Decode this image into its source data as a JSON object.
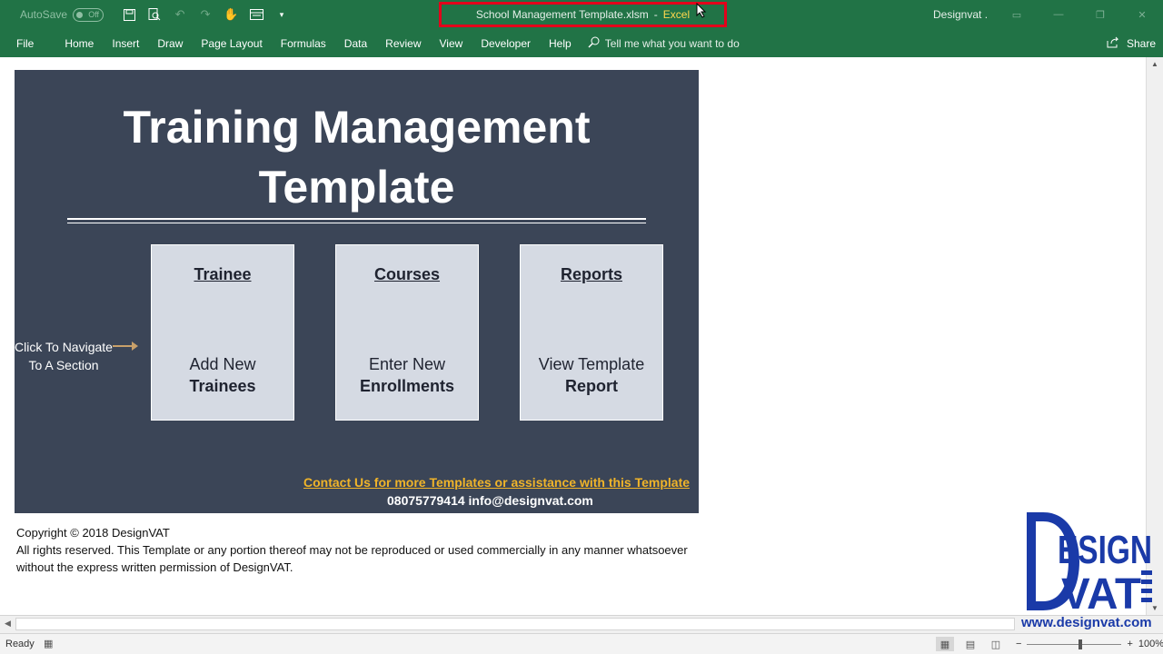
{
  "titlebar": {
    "autosave_label": "AutoSave",
    "autosave_state": "Off",
    "document_name": "School Management Template.xlsm",
    "separator": "-",
    "app_name": "Excel",
    "user_name": "Designvat ."
  },
  "ribbon": {
    "tabs": [
      "File",
      "Home",
      "Insert",
      "Draw",
      "Page Layout",
      "Formulas",
      "Data",
      "Review",
      "View",
      "Developer",
      "Help"
    ],
    "tell_me": "Tell me what you want to do",
    "share": "Share"
  },
  "dashboard": {
    "title_line1": "Training Management",
    "title_line2": "Template",
    "nav_hint_line1": "Click To Navigate",
    "nav_hint_line2": "To A Section",
    "cards": [
      {
        "title": "Trainee",
        "line1": "Add New",
        "line2": "Trainees"
      },
      {
        "title": "Courses",
        "line1": "Enter New",
        "line2": "Enrollments"
      },
      {
        "title": "Reports",
        "line1": "View Template",
        "line2": "Report"
      }
    ],
    "contact_link": "Contact Us for more Templates or assistance with this Template",
    "contact_details": "08075779414  info@designvat.com"
  },
  "copyright": {
    "line1": "Copyright © 2018 DesignVAT",
    "line2": "All rights reserved. This Template or any portion thereof may not be reproduced or used commercially in any manner whatsoever",
    "line3": "without the express written permission of DesignVAT."
  },
  "logo": {
    "text_top": "ESIGN",
    "text_bottom": "VAT",
    "url": "www.designvat.com"
  },
  "statusbar": {
    "status": "Ready",
    "zoom": "100%"
  },
  "colors": {
    "excel_green": "#217346",
    "panel": "#3b4557",
    "card": "#d5dae3",
    "contact_link": "#f0b429",
    "logo_blue": "#1a3aa8",
    "highlight_red": "#e3001b"
  }
}
